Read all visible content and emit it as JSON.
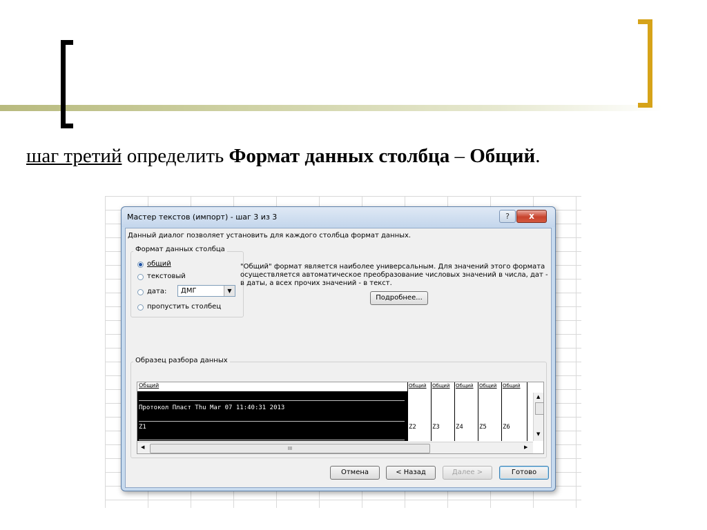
{
  "slide": {
    "heading_part1": "шаг третий",
    "heading_part2": " определить ",
    "heading_part3": "Формат данных столбца",
    "heading_part4": " – ",
    "heading_part5": "Общий",
    "heading_part6": ".",
    "bracket_left_color": "#000000",
    "bracket_right_color": "#d6a319"
  },
  "dialog": {
    "title": "Мастер текстов (импорт) - шаг 3 из 3",
    "help_label": "?",
    "close_label": "x",
    "description": "Данный диалог позволяет установить для каждого столбца формат данных.",
    "format_group_label": "Формат данных столбца",
    "radios": [
      {
        "label": "общий",
        "checked": true
      },
      {
        "label": "текстовый",
        "checked": false
      },
      {
        "label": "дата:",
        "checked": false
      },
      {
        "label": "пропустить столбец",
        "checked": false
      }
    ],
    "date_combo_value": "ДМГ",
    "info_line1": "\"Общий\" формат является наиболее универсальным. Для значений этого формата",
    "info_line2": "осуществляется автоматическое преобразование числовых значений в числа, дат -",
    "info_line3": "в даты, а всех прочих значений - в текст.",
    "details_button": "Подробнее...",
    "preview_group_label": "Образец разбора данных",
    "preview": {
      "col0_header": "Общий",
      "col_headers": [
        "Общий",
        "Общий",
        "Общий",
        "Общий",
        "Общий"
      ],
      "row1": "Протокол Пласт Thu Mar 07 11:40:31 2013",
      "row2_col0": "Z1",
      "row2_cols": [
        "Z2",
        "Z3",
        "Z4",
        "Z5",
        "Z6"
      ],
      "hscroll_mid": "III"
    },
    "buttons": {
      "cancel": "Отмена",
      "back": "< Назад",
      "next": "Далее >",
      "finish": "Готово"
    }
  }
}
